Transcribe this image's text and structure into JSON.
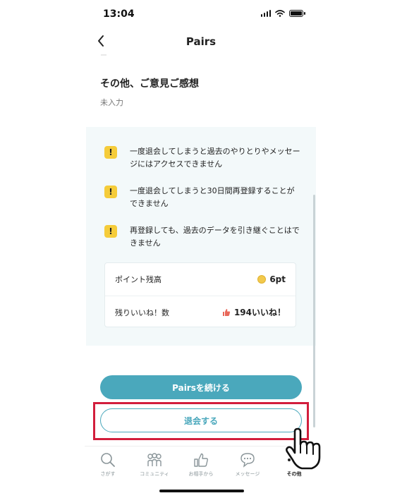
{
  "status_bar": {
    "time": "13:04"
  },
  "header": {
    "title": "Pairs"
  },
  "form": {
    "faint_text": "ー",
    "feedback_label": "その他、ご意見ご感想",
    "feedback_placeholder": "未入力"
  },
  "warnings": [
    {
      "badge": "!",
      "text": "一度退会してしまうと過去のやりとりやメッセージにはアクセスできません"
    },
    {
      "badge": "!",
      "text": "一度退会してしまうと30日間再登録することができません"
    },
    {
      "badge": "!",
      "text": "再登録しても、過去のデータを引き継ぐことはできません"
    }
  ],
  "stats": [
    {
      "label": "ポイント残高",
      "value": "6pt",
      "icon": "coin-icon"
    },
    {
      "label": "残りいいね！数",
      "value": "194いいね！",
      "icon": "thumbs-up-icon"
    }
  ],
  "buttons": {
    "continue": "Pairsを続ける",
    "withdraw": "退会する"
  },
  "tabs": [
    {
      "label": "さがす",
      "icon": "search-icon"
    },
    {
      "label": "コミュニティ",
      "icon": "community-icon"
    },
    {
      "label": "お相手から",
      "icon": "thumbs-up-icon"
    },
    {
      "label": "メッセージ",
      "icon": "message-icon"
    },
    {
      "label": "その他",
      "icon": "more-icon",
      "active": true
    }
  ],
  "colors": {
    "accent": "#4aa8bc",
    "warning": "#f5cc3a",
    "highlight": "#d21e3c",
    "panel": "#f3f9fa"
  }
}
